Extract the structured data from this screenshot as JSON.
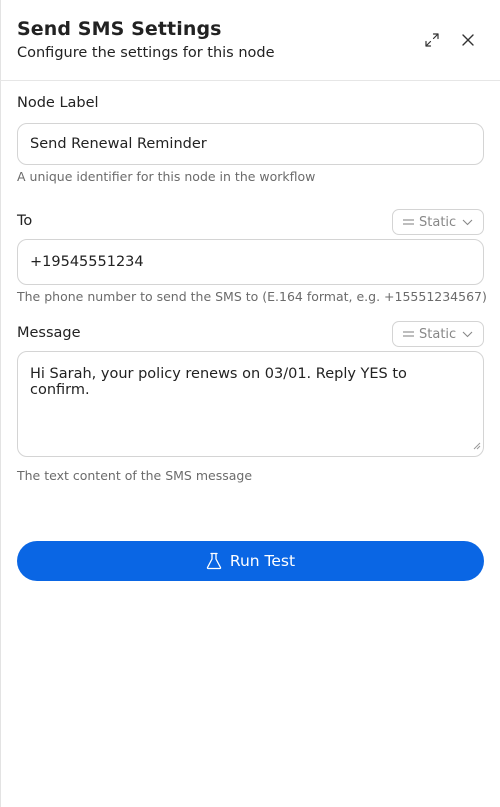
{
  "header": {
    "title": "Send SMS Settings",
    "subtitle": "Configure the settings for this node",
    "expand_icon": "expand-icon",
    "close_icon": "close-icon"
  },
  "fields": {
    "node_label": {
      "label": "Node Label",
      "value": "Send Renewal Reminder",
      "helper": "A unique identifier for this node in the workflow"
    },
    "to": {
      "label": "To",
      "mode": "Static",
      "value": "+19545551234",
      "helper": "The phone number to send the SMS to (E.164 format, e.g. +15551234567)"
    },
    "message": {
      "label": "Message",
      "mode": "Static",
      "value": "Hi Sarah, your policy renews on 03/01. Reply YES to confirm.",
      "helper": "The text content of the SMS message"
    }
  },
  "actions": {
    "run_test_label": "Run Test",
    "run_test_icon": "flask-icon",
    "accent_color": "#0a66e4"
  }
}
